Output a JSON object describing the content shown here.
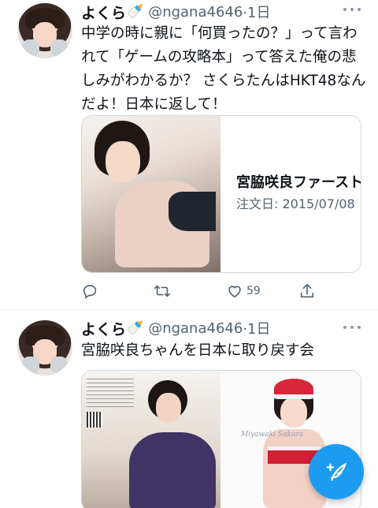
{
  "tweets": [
    {
      "name": "よくら",
      "badge": "🍼",
      "handle": "@ngana4646",
      "time": "·1日",
      "text": "中学の時に親に「何買ったの？」って言われて「ゲームの攻略本」って答えた俺の悲しみがわかるか？ さくらたんはHKT48なんだよ！日本に返して！",
      "card": {
        "title": "宮脇咲良ファースト",
        "subtitle": "注文日: 2015/07/08"
      },
      "actions": {
        "reply": "",
        "retweet": "",
        "like": "59",
        "share": ""
      }
    },
    {
      "name": "よくら",
      "badge": "🍼",
      "handle": "@ngana4646",
      "time": "·1日",
      "text": "宮脇咲良ちゃんを日本に取り戻す会",
      "media_caption": "Miyawaki Sakura"
    }
  ],
  "colors": {
    "accent": "#1d9bf0",
    "text": "#0f1419",
    "muted": "#536471",
    "border": "#cfd9de"
  },
  "icons": [
    "more-icon",
    "reply-icon",
    "retweet-icon",
    "like-icon",
    "share-icon",
    "compose-icon"
  ]
}
